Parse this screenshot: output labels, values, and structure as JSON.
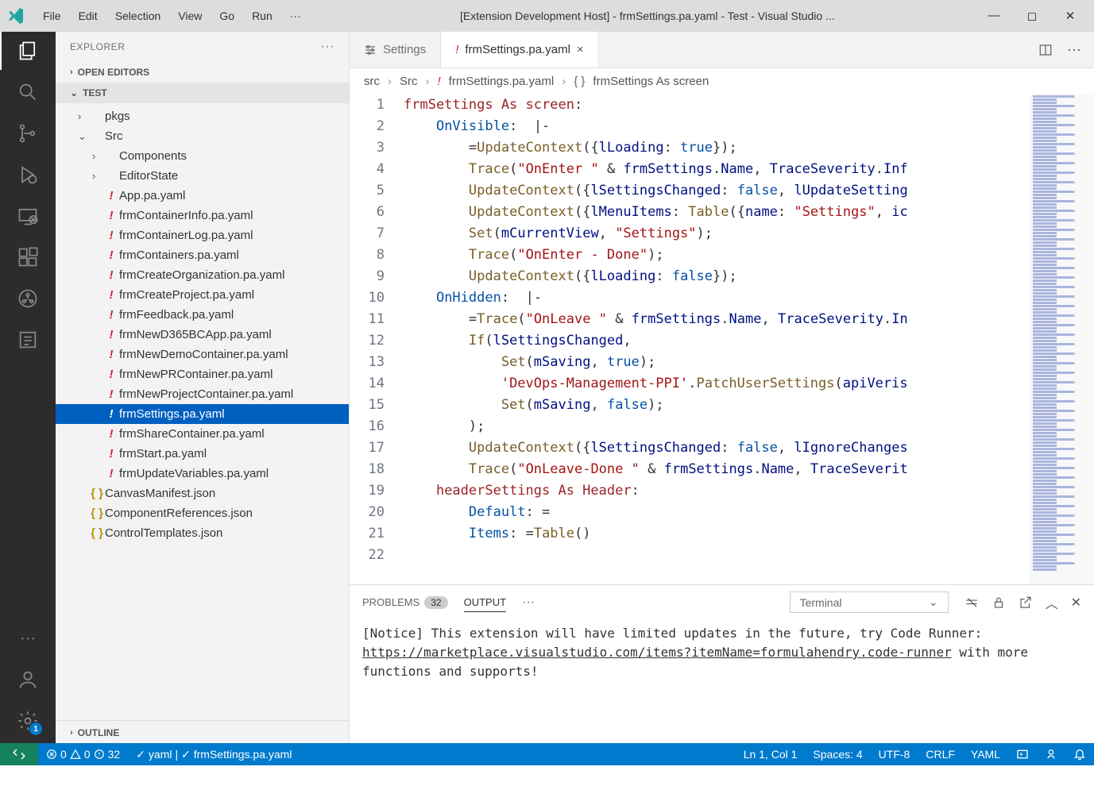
{
  "titlebar": {
    "menu": [
      "File",
      "Edit",
      "Selection",
      "View",
      "Go",
      "Run",
      "···"
    ],
    "title": "[Extension Development Host] - frmSettings.pa.yaml - Test - Visual Studio ..."
  },
  "sidebar": {
    "header": "EXPLORER",
    "open_editors": "OPEN EDITORS",
    "test_section": "TEST",
    "outline": "OUTLINE",
    "tree": [
      {
        "depth": 1,
        "chev": "›",
        "icon": "",
        "label": "pkgs",
        "type": "folder"
      },
      {
        "depth": 1,
        "chev": "⌄",
        "icon": "",
        "label": "Src",
        "type": "folder"
      },
      {
        "depth": 2,
        "chev": "›",
        "icon": "",
        "label": "Components",
        "type": "folder"
      },
      {
        "depth": 2,
        "chev": "›",
        "icon": "",
        "label": "EditorState",
        "type": "folder"
      },
      {
        "depth": 2,
        "chev": "",
        "icon": "!",
        "label": "App.pa.yaml",
        "type": "yaml"
      },
      {
        "depth": 2,
        "chev": "",
        "icon": "!",
        "label": "frmContainerInfo.pa.yaml",
        "type": "yaml"
      },
      {
        "depth": 2,
        "chev": "",
        "icon": "!",
        "label": "frmContainerLog.pa.yaml",
        "type": "yaml"
      },
      {
        "depth": 2,
        "chev": "",
        "icon": "!",
        "label": "frmContainers.pa.yaml",
        "type": "yaml"
      },
      {
        "depth": 2,
        "chev": "",
        "icon": "!",
        "label": "frmCreateOrganization.pa.yaml",
        "type": "yaml"
      },
      {
        "depth": 2,
        "chev": "",
        "icon": "!",
        "label": "frmCreateProject.pa.yaml",
        "type": "yaml"
      },
      {
        "depth": 2,
        "chev": "",
        "icon": "!",
        "label": "frmFeedback.pa.yaml",
        "type": "yaml"
      },
      {
        "depth": 2,
        "chev": "",
        "icon": "!",
        "label": "frmNewD365BCApp.pa.yaml",
        "type": "yaml"
      },
      {
        "depth": 2,
        "chev": "",
        "icon": "!",
        "label": "frmNewDemoContainer.pa.yaml",
        "type": "yaml"
      },
      {
        "depth": 2,
        "chev": "",
        "icon": "!",
        "label": "frmNewPRContainer.pa.yaml",
        "type": "yaml"
      },
      {
        "depth": 2,
        "chev": "",
        "icon": "!",
        "label": "frmNewProjectContainer.pa.yaml",
        "type": "yaml"
      },
      {
        "depth": 2,
        "chev": "",
        "icon": "!",
        "label": "frmSettings.pa.yaml",
        "type": "yaml",
        "selected": true
      },
      {
        "depth": 2,
        "chev": "",
        "icon": "!",
        "label": "frmShareContainer.pa.yaml",
        "type": "yaml"
      },
      {
        "depth": 2,
        "chev": "",
        "icon": "!",
        "label": "frmStart.pa.yaml",
        "type": "yaml"
      },
      {
        "depth": 2,
        "chev": "",
        "icon": "!",
        "label": "frmUpdateVariables.pa.yaml",
        "type": "yaml"
      },
      {
        "depth": 1,
        "chev": "",
        "icon": "{ }",
        "label": "CanvasManifest.json",
        "type": "json"
      },
      {
        "depth": 1,
        "chev": "",
        "icon": "{ }",
        "label": "ComponentReferences.json",
        "type": "json"
      },
      {
        "depth": 1,
        "chev": "",
        "icon": "{ }",
        "label": "ControlTemplates.json",
        "type": "json"
      }
    ]
  },
  "tabs": {
    "items": [
      {
        "icon": "⚙",
        "label": "Settings",
        "active": false
      },
      {
        "icon": "!",
        "label": "frmSettings.pa.yaml",
        "active": true,
        "close": "×"
      }
    ]
  },
  "breadcrumb": {
    "parts": [
      "src",
      "Src",
      "frmSettings.pa.yaml",
      "frmSettings As screen"
    ]
  },
  "code": {
    "lines": [
      1,
      2,
      3,
      4,
      5,
      6,
      7,
      8,
      9,
      10,
      11,
      12,
      13,
      14,
      15,
      16,
      17,
      18,
      19,
      20,
      21,
      22
    ]
  },
  "panel": {
    "problems_label": "PROBLEMS",
    "problems_badge": "32",
    "output_label": "OUTPUT",
    "select": "Terminal",
    "body_notice": "[Notice] This extension will have limited updates in the future, try Code Runner: ",
    "body_link": "https://marketplace.visualstudio.com/items?itemName=formulahendry.code-runner",
    "body_tail": " with more functions and supports!"
  },
  "statusbar": {
    "errors": "0",
    "warnings": "0",
    "info": "32",
    "lang_status": "yaml",
    "file_status": "frmSettings.pa.yaml",
    "cursor": "Ln 1, Col 1",
    "spaces": "Spaces: 4",
    "encoding": "UTF-8",
    "eol": "CRLF",
    "lang": "YAML"
  }
}
